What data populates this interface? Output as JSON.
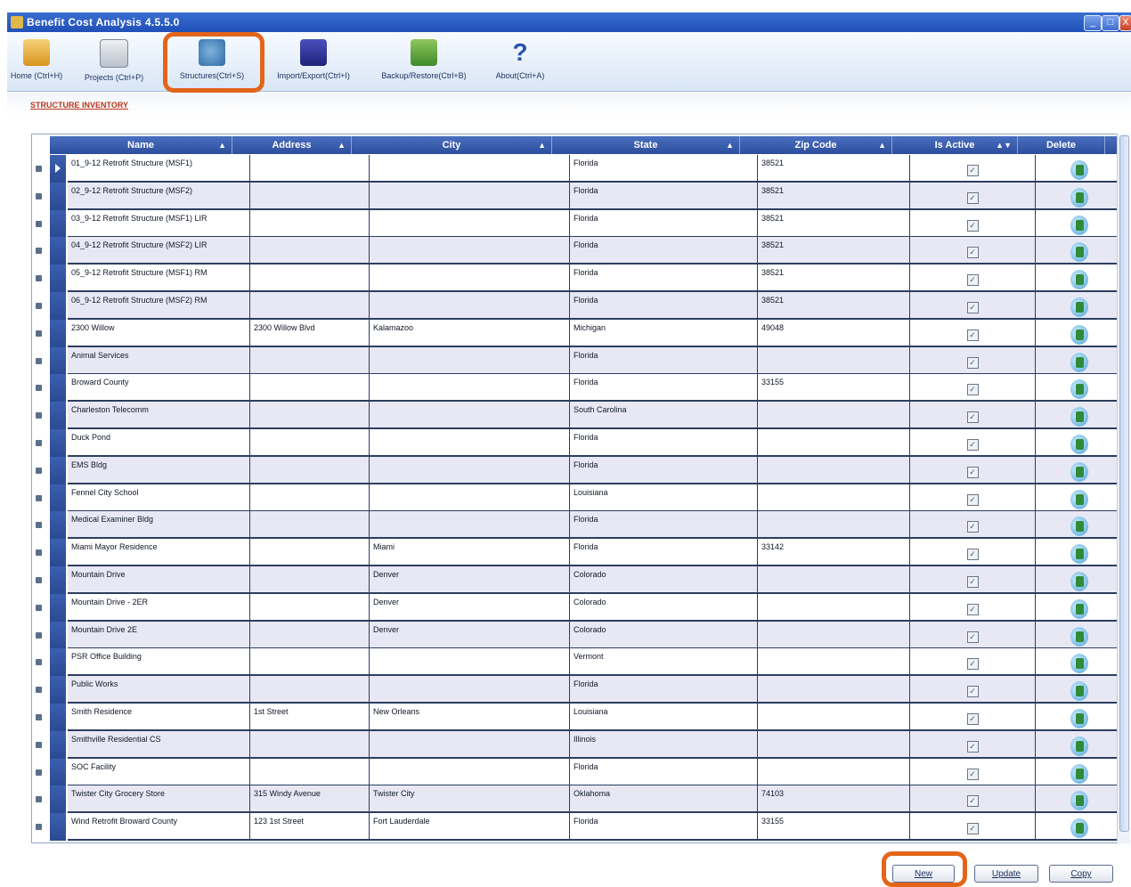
{
  "window": {
    "title": "Benefit Cost Analysis 4.5.5.0",
    "controls": [
      "_",
      "□",
      "X"
    ]
  },
  "toolbar": {
    "items": [
      {
        "label": "Home (Ctrl+H)",
        "icon": "home-icon"
      },
      {
        "label": "Projects (Ctrl+P)",
        "icon": "projects-icon"
      },
      {
        "label": "Structures(Ctrl+S)",
        "icon": "structures-icon"
      },
      {
        "label": "Import/Export(Ctrl+I)",
        "icon": "import-export-icon"
      },
      {
        "label": "Backup/Restore(Ctrl+B)",
        "icon": "backup-restore-icon"
      },
      {
        "label": "About(Ctrl+A)",
        "icon": "about-icon",
        "glyph": "?"
      }
    ],
    "active": "Structures(Ctrl+S)",
    "highlight_color": "#e2651a"
  },
  "breadcrumb": "STRUCTURE INVENTORY",
  "grid": {
    "columns": [
      "Name",
      "Address",
      "City",
      "State",
      "Zip Code",
      "Is Active",
      "Delete"
    ],
    "sort_glyphs": [
      "▲",
      "▲",
      "▲",
      "▲",
      "▲",
      "▲▼",
      ""
    ],
    "rows": [
      {
        "name": "01_9-12 Retrofit Structure (MSF1)",
        "address": "",
        "city": "",
        "state": "Florida",
        "zip": "38521",
        "active": "✓"
      },
      {
        "name": "02_9-12 Retrofit Structure (MSF2)",
        "address": "",
        "city": "",
        "state": "Florida",
        "zip": "38521",
        "active": "✓"
      },
      {
        "name": "03_9-12 Retrofit Structure (MSF1) LIR",
        "address": "",
        "city": "",
        "state": "Florida",
        "zip": "38521",
        "active": "✓"
      },
      {
        "name": "04_9-12 Retrofit Structure (MSF2) LIR",
        "address": "",
        "city": "",
        "state": "Florida",
        "zip": "38521",
        "active": "✓"
      },
      {
        "name": "05_9-12 Retrofit Structure (MSF1) RM",
        "address": "",
        "city": "",
        "state": "Florida",
        "zip": "38521",
        "active": "✓"
      },
      {
        "name": "06_9-12 Retrofit Structure (MSF2) RM",
        "address": "",
        "city": "",
        "state": "Florida",
        "zip": "38521",
        "active": "✓"
      },
      {
        "name": "2300 Willow",
        "address": "2300 Willow Blvd",
        "city": "Kalamazoo",
        "state": "Michigan",
        "zip": "49048",
        "active": "✓"
      },
      {
        "name": "Animal Services",
        "address": "",
        "city": "",
        "state": "Florida",
        "zip": "",
        "active": "✓"
      },
      {
        "name": "Broward County",
        "address": "",
        "city": "",
        "state": "Florida",
        "zip": "33155",
        "active": "✓"
      },
      {
        "name": "Charleston Telecomm",
        "address": "",
        "city": "",
        "state": "South Carolina",
        "zip": "",
        "active": "✓"
      },
      {
        "name": "Duck Pond",
        "address": "",
        "city": "",
        "state": "Florida",
        "zip": "",
        "active": "✓"
      },
      {
        "name": "EMS Bldg",
        "address": "",
        "city": "",
        "state": "Florida",
        "zip": "",
        "active": "✓"
      },
      {
        "name": "Fennel City School",
        "address": "",
        "city": "",
        "state": "Louisiana",
        "zip": "",
        "active": "✓"
      },
      {
        "name": "Medical Examiner Bldg",
        "address": "",
        "city": "",
        "state": "Florida",
        "zip": "",
        "active": "✓"
      },
      {
        "name": "Miami Mayor Residence",
        "address": "",
        "city": "Miami",
        "state": "Florida",
        "zip": "33142",
        "active": "✓"
      },
      {
        "name": "Mountain Drive",
        "address": "",
        "city": "Denver",
        "state": "Colorado",
        "zip": "",
        "active": "✓"
      },
      {
        "name": "Mountain Drive - 2ER",
        "address": "",
        "city": "Denver",
        "state": "Colorado",
        "zip": "",
        "active": "✓"
      },
      {
        "name": "Mountain Drive 2E",
        "address": "",
        "city": "Denver",
        "state": "Colorado",
        "zip": "",
        "active": "✓"
      },
      {
        "name": "PSR Office Building",
        "address": "",
        "city": "",
        "state": "Vermont",
        "zip": "",
        "active": "✓"
      },
      {
        "name": "Public Works",
        "address": "",
        "city": "",
        "state": "Florida",
        "zip": "",
        "active": "✓"
      },
      {
        "name": "Smith Residence",
        "address": "1st Street",
        "city": "New Orleans",
        "state": "Louisiana",
        "zip": "",
        "active": "✓"
      },
      {
        "name": "Smithville Residential CS",
        "address": "",
        "city": "",
        "state": "Illinois",
        "zip": "",
        "active": "✓"
      },
      {
        "name": "SOC Facility",
        "address": "",
        "city": "",
        "state": "Florida",
        "zip": "",
        "active": "✓"
      },
      {
        "name": "Twister City Grocery Store",
        "address": "315 Windy Avenue",
        "city": "Twister City",
        "state": "Oklahoma",
        "zip": "74103",
        "active": "✓"
      },
      {
        "name": "Wind Retrofit Broward County",
        "address": "123 1st Street",
        "city": "Fort Lauderdale",
        "state": "Florida",
        "zip": "33155",
        "active": "✓"
      }
    ]
  },
  "buttons": {
    "new": "New",
    "update": "Update",
    "copy": "Copy"
  },
  "colors": {
    "header": "#2c4e9c",
    "row_alt": "#e8e8f4",
    "highlight": "#e2651a"
  }
}
